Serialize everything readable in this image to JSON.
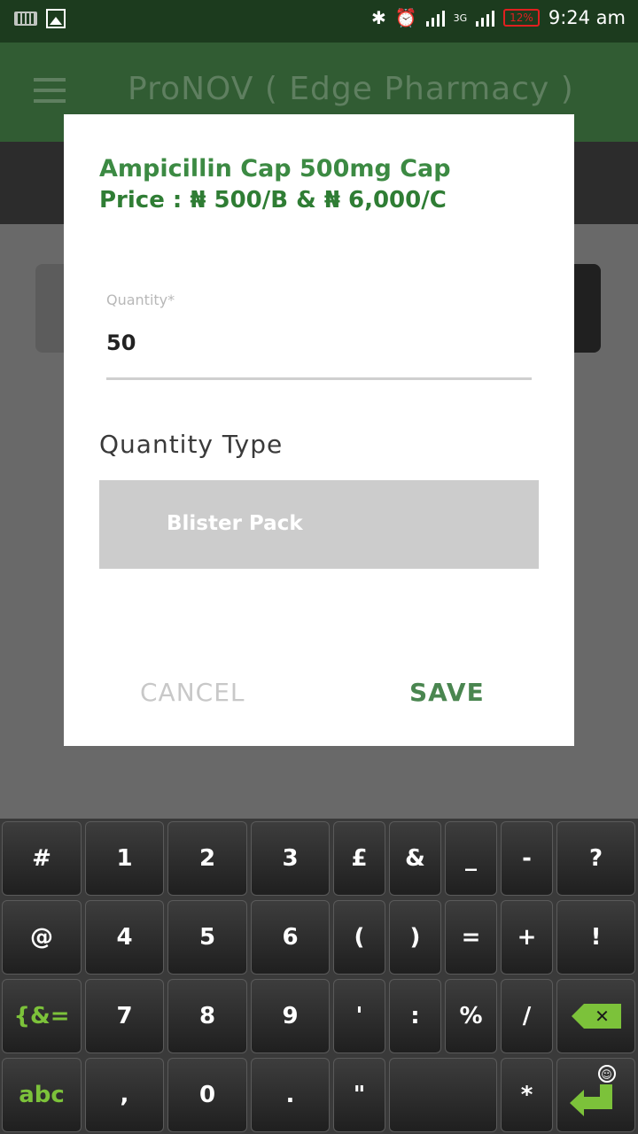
{
  "status_bar": {
    "time": "9:24 am",
    "battery": "12%",
    "network": "3G"
  },
  "app_bar": {
    "title": "ProNOV ( Edge Pharmacy )"
  },
  "dialog": {
    "drug_name": "Ampicillin Cap 500mg Cap",
    "price": "Price : ₦ 500/B & ₦ 6,000/C",
    "quantity_label": "Quantity*",
    "quantity_value": "50",
    "quantity_type_title": "Quantity Type",
    "quantity_type_selected": "Blister Pack",
    "cancel_label": "CANCEL",
    "save_label": "SAVE"
  },
  "keyboard": {
    "rows": [
      [
        "#",
        "1",
        "2",
        "3",
        "£",
        "&",
        "_",
        "-",
        "?"
      ],
      [
        "@",
        "4",
        "5",
        "6",
        "(",
        ")",
        "=",
        "+",
        "!"
      ],
      [
        "{&=",
        "7",
        "8",
        "9",
        "'",
        ":",
        "%",
        "/",
        "backspace"
      ],
      [
        "abc",
        ",",
        "0",
        ".",
        "\"",
        "space",
        "*",
        "enter"
      ]
    ],
    "accent_color": "#7cc23a"
  },
  "colors": {
    "status_bar": "#1c3b1e",
    "app_bar": "#315c33",
    "primary_green": "#3c8a43",
    "dim_overlay": "#696969"
  }
}
